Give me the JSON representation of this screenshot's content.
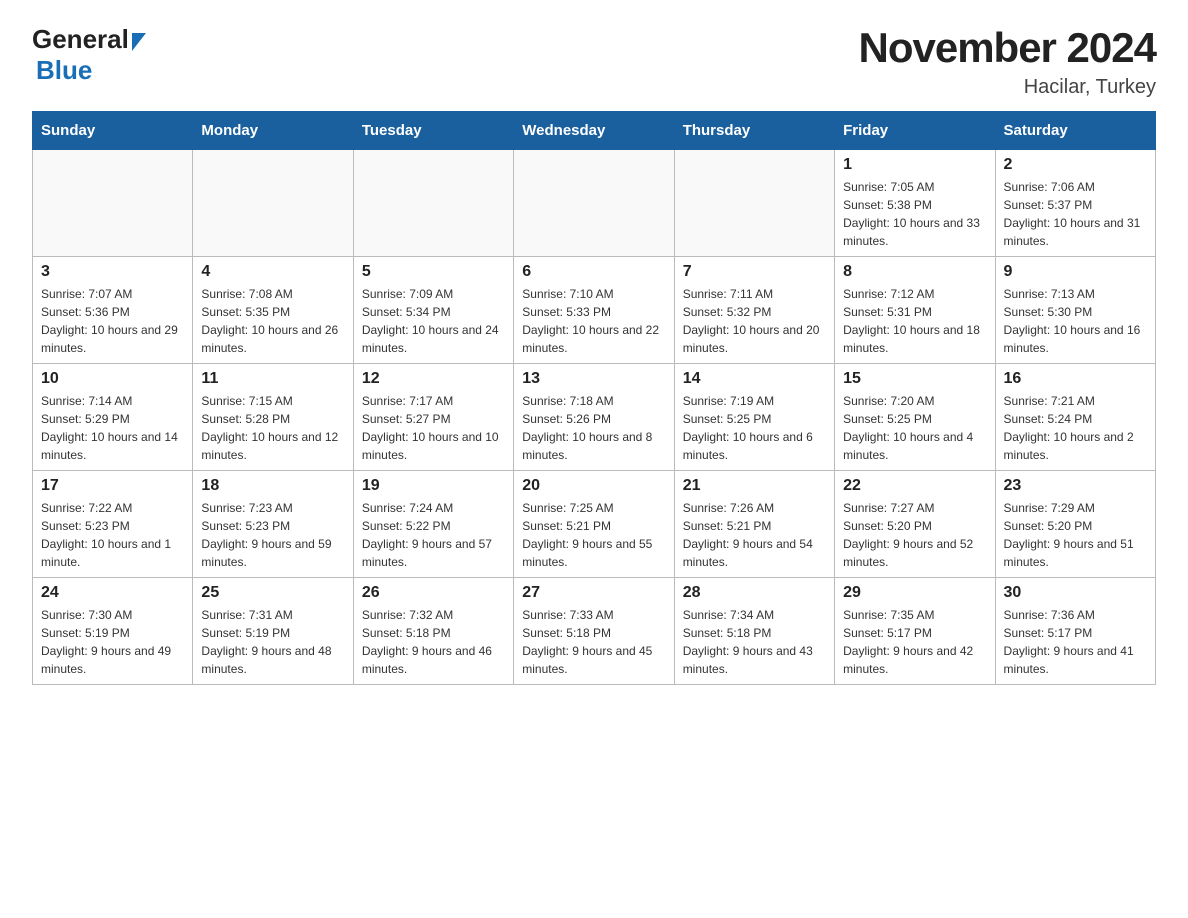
{
  "header": {
    "title": "November 2024",
    "subtitle": "Hacilar, Turkey"
  },
  "weekdays": [
    "Sunday",
    "Monday",
    "Tuesday",
    "Wednesday",
    "Thursday",
    "Friday",
    "Saturday"
  ],
  "weeks": [
    [
      {
        "day": "",
        "info": ""
      },
      {
        "day": "",
        "info": ""
      },
      {
        "day": "",
        "info": ""
      },
      {
        "day": "",
        "info": ""
      },
      {
        "day": "",
        "info": ""
      },
      {
        "day": "1",
        "info": "Sunrise: 7:05 AM\nSunset: 5:38 PM\nDaylight: 10 hours and 33 minutes."
      },
      {
        "day": "2",
        "info": "Sunrise: 7:06 AM\nSunset: 5:37 PM\nDaylight: 10 hours and 31 minutes."
      }
    ],
    [
      {
        "day": "3",
        "info": "Sunrise: 7:07 AM\nSunset: 5:36 PM\nDaylight: 10 hours and 29 minutes."
      },
      {
        "day": "4",
        "info": "Sunrise: 7:08 AM\nSunset: 5:35 PM\nDaylight: 10 hours and 26 minutes."
      },
      {
        "day": "5",
        "info": "Sunrise: 7:09 AM\nSunset: 5:34 PM\nDaylight: 10 hours and 24 minutes."
      },
      {
        "day": "6",
        "info": "Sunrise: 7:10 AM\nSunset: 5:33 PM\nDaylight: 10 hours and 22 minutes."
      },
      {
        "day": "7",
        "info": "Sunrise: 7:11 AM\nSunset: 5:32 PM\nDaylight: 10 hours and 20 minutes."
      },
      {
        "day": "8",
        "info": "Sunrise: 7:12 AM\nSunset: 5:31 PM\nDaylight: 10 hours and 18 minutes."
      },
      {
        "day": "9",
        "info": "Sunrise: 7:13 AM\nSunset: 5:30 PM\nDaylight: 10 hours and 16 minutes."
      }
    ],
    [
      {
        "day": "10",
        "info": "Sunrise: 7:14 AM\nSunset: 5:29 PM\nDaylight: 10 hours and 14 minutes."
      },
      {
        "day": "11",
        "info": "Sunrise: 7:15 AM\nSunset: 5:28 PM\nDaylight: 10 hours and 12 minutes."
      },
      {
        "day": "12",
        "info": "Sunrise: 7:17 AM\nSunset: 5:27 PM\nDaylight: 10 hours and 10 minutes."
      },
      {
        "day": "13",
        "info": "Sunrise: 7:18 AM\nSunset: 5:26 PM\nDaylight: 10 hours and 8 minutes."
      },
      {
        "day": "14",
        "info": "Sunrise: 7:19 AM\nSunset: 5:25 PM\nDaylight: 10 hours and 6 minutes."
      },
      {
        "day": "15",
        "info": "Sunrise: 7:20 AM\nSunset: 5:25 PM\nDaylight: 10 hours and 4 minutes."
      },
      {
        "day": "16",
        "info": "Sunrise: 7:21 AM\nSunset: 5:24 PM\nDaylight: 10 hours and 2 minutes."
      }
    ],
    [
      {
        "day": "17",
        "info": "Sunrise: 7:22 AM\nSunset: 5:23 PM\nDaylight: 10 hours and 1 minute."
      },
      {
        "day": "18",
        "info": "Sunrise: 7:23 AM\nSunset: 5:23 PM\nDaylight: 9 hours and 59 minutes."
      },
      {
        "day": "19",
        "info": "Sunrise: 7:24 AM\nSunset: 5:22 PM\nDaylight: 9 hours and 57 minutes."
      },
      {
        "day": "20",
        "info": "Sunrise: 7:25 AM\nSunset: 5:21 PM\nDaylight: 9 hours and 55 minutes."
      },
      {
        "day": "21",
        "info": "Sunrise: 7:26 AM\nSunset: 5:21 PM\nDaylight: 9 hours and 54 minutes."
      },
      {
        "day": "22",
        "info": "Sunrise: 7:27 AM\nSunset: 5:20 PM\nDaylight: 9 hours and 52 minutes."
      },
      {
        "day": "23",
        "info": "Sunrise: 7:29 AM\nSunset: 5:20 PM\nDaylight: 9 hours and 51 minutes."
      }
    ],
    [
      {
        "day": "24",
        "info": "Sunrise: 7:30 AM\nSunset: 5:19 PM\nDaylight: 9 hours and 49 minutes."
      },
      {
        "day": "25",
        "info": "Sunrise: 7:31 AM\nSunset: 5:19 PM\nDaylight: 9 hours and 48 minutes."
      },
      {
        "day": "26",
        "info": "Sunrise: 7:32 AM\nSunset: 5:18 PM\nDaylight: 9 hours and 46 minutes."
      },
      {
        "day": "27",
        "info": "Sunrise: 7:33 AM\nSunset: 5:18 PM\nDaylight: 9 hours and 45 minutes."
      },
      {
        "day": "28",
        "info": "Sunrise: 7:34 AM\nSunset: 5:18 PM\nDaylight: 9 hours and 43 minutes."
      },
      {
        "day": "29",
        "info": "Sunrise: 7:35 AM\nSunset: 5:17 PM\nDaylight: 9 hours and 42 minutes."
      },
      {
        "day": "30",
        "info": "Sunrise: 7:36 AM\nSunset: 5:17 PM\nDaylight: 9 hours and 41 minutes."
      }
    ]
  ]
}
